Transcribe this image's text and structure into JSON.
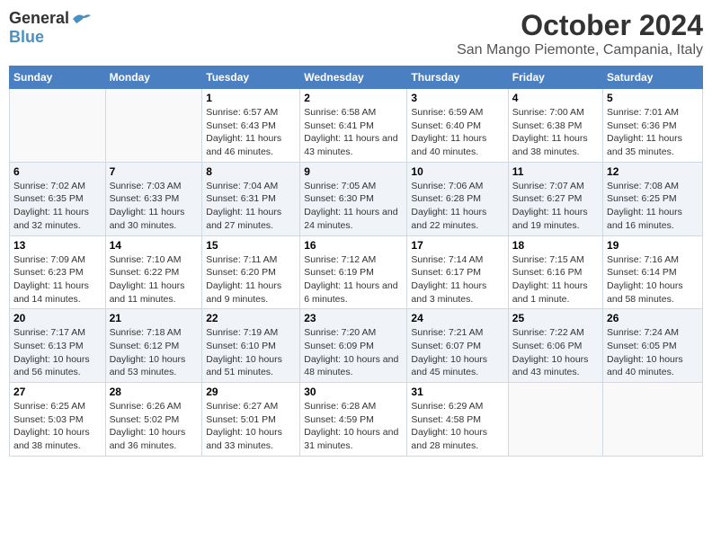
{
  "logo": {
    "general": "General",
    "blue": "Blue"
  },
  "title": "October 2024",
  "location": "San Mango Piemonte, Campania, Italy",
  "weekdays": [
    "Sunday",
    "Monday",
    "Tuesday",
    "Wednesday",
    "Thursday",
    "Friday",
    "Saturday"
  ],
  "weeks": [
    [
      {
        "day": "",
        "sunrise": "",
        "sunset": "",
        "daylight": ""
      },
      {
        "day": "",
        "sunrise": "",
        "sunset": "",
        "daylight": ""
      },
      {
        "day": "1",
        "sunrise": "Sunrise: 6:57 AM",
        "sunset": "Sunset: 6:43 PM",
        "daylight": "Daylight: 11 hours and 46 minutes."
      },
      {
        "day": "2",
        "sunrise": "Sunrise: 6:58 AM",
        "sunset": "Sunset: 6:41 PM",
        "daylight": "Daylight: 11 hours and 43 minutes."
      },
      {
        "day": "3",
        "sunrise": "Sunrise: 6:59 AM",
        "sunset": "Sunset: 6:40 PM",
        "daylight": "Daylight: 11 hours and 40 minutes."
      },
      {
        "day": "4",
        "sunrise": "Sunrise: 7:00 AM",
        "sunset": "Sunset: 6:38 PM",
        "daylight": "Daylight: 11 hours and 38 minutes."
      },
      {
        "day": "5",
        "sunrise": "Sunrise: 7:01 AM",
        "sunset": "Sunset: 6:36 PM",
        "daylight": "Daylight: 11 hours and 35 minutes."
      }
    ],
    [
      {
        "day": "6",
        "sunrise": "Sunrise: 7:02 AM",
        "sunset": "Sunset: 6:35 PM",
        "daylight": "Daylight: 11 hours and 32 minutes."
      },
      {
        "day": "7",
        "sunrise": "Sunrise: 7:03 AM",
        "sunset": "Sunset: 6:33 PM",
        "daylight": "Daylight: 11 hours and 30 minutes."
      },
      {
        "day": "8",
        "sunrise": "Sunrise: 7:04 AM",
        "sunset": "Sunset: 6:31 PM",
        "daylight": "Daylight: 11 hours and 27 minutes."
      },
      {
        "day": "9",
        "sunrise": "Sunrise: 7:05 AM",
        "sunset": "Sunset: 6:30 PM",
        "daylight": "Daylight: 11 hours and 24 minutes."
      },
      {
        "day": "10",
        "sunrise": "Sunrise: 7:06 AM",
        "sunset": "Sunset: 6:28 PM",
        "daylight": "Daylight: 11 hours and 22 minutes."
      },
      {
        "day": "11",
        "sunrise": "Sunrise: 7:07 AM",
        "sunset": "Sunset: 6:27 PM",
        "daylight": "Daylight: 11 hours and 19 minutes."
      },
      {
        "day": "12",
        "sunrise": "Sunrise: 7:08 AM",
        "sunset": "Sunset: 6:25 PM",
        "daylight": "Daylight: 11 hours and 16 minutes."
      }
    ],
    [
      {
        "day": "13",
        "sunrise": "Sunrise: 7:09 AM",
        "sunset": "Sunset: 6:23 PM",
        "daylight": "Daylight: 11 hours and 14 minutes."
      },
      {
        "day": "14",
        "sunrise": "Sunrise: 7:10 AM",
        "sunset": "Sunset: 6:22 PM",
        "daylight": "Daylight: 11 hours and 11 minutes."
      },
      {
        "day": "15",
        "sunrise": "Sunrise: 7:11 AM",
        "sunset": "Sunset: 6:20 PM",
        "daylight": "Daylight: 11 hours and 9 minutes."
      },
      {
        "day": "16",
        "sunrise": "Sunrise: 7:12 AM",
        "sunset": "Sunset: 6:19 PM",
        "daylight": "Daylight: 11 hours and 6 minutes."
      },
      {
        "day": "17",
        "sunrise": "Sunrise: 7:14 AM",
        "sunset": "Sunset: 6:17 PM",
        "daylight": "Daylight: 11 hours and 3 minutes."
      },
      {
        "day": "18",
        "sunrise": "Sunrise: 7:15 AM",
        "sunset": "Sunset: 6:16 PM",
        "daylight": "Daylight: 11 hours and 1 minute."
      },
      {
        "day": "19",
        "sunrise": "Sunrise: 7:16 AM",
        "sunset": "Sunset: 6:14 PM",
        "daylight": "Daylight: 10 hours and 58 minutes."
      }
    ],
    [
      {
        "day": "20",
        "sunrise": "Sunrise: 7:17 AM",
        "sunset": "Sunset: 6:13 PM",
        "daylight": "Daylight: 10 hours and 56 minutes."
      },
      {
        "day": "21",
        "sunrise": "Sunrise: 7:18 AM",
        "sunset": "Sunset: 6:12 PM",
        "daylight": "Daylight: 10 hours and 53 minutes."
      },
      {
        "day": "22",
        "sunrise": "Sunrise: 7:19 AM",
        "sunset": "Sunset: 6:10 PM",
        "daylight": "Daylight: 10 hours and 51 minutes."
      },
      {
        "day": "23",
        "sunrise": "Sunrise: 7:20 AM",
        "sunset": "Sunset: 6:09 PM",
        "daylight": "Daylight: 10 hours and 48 minutes."
      },
      {
        "day": "24",
        "sunrise": "Sunrise: 7:21 AM",
        "sunset": "Sunset: 6:07 PM",
        "daylight": "Daylight: 10 hours and 45 minutes."
      },
      {
        "day": "25",
        "sunrise": "Sunrise: 7:22 AM",
        "sunset": "Sunset: 6:06 PM",
        "daylight": "Daylight: 10 hours and 43 minutes."
      },
      {
        "day": "26",
        "sunrise": "Sunrise: 7:24 AM",
        "sunset": "Sunset: 6:05 PM",
        "daylight": "Daylight: 10 hours and 40 minutes."
      }
    ],
    [
      {
        "day": "27",
        "sunrise": "Sunrise: 6:25 AM",
        "sunset": "Sunset: 5:03 PM",
        "daylight": "Daylight: 10 hours and 38 minutes."
      },
      {
        "day": "28",
        "sunrise": "Sunrise: 6:26 AM",
        "sunset": "Sunset: 5:02 PM",
        "daylight": "Daylight: 10 hours and 36 minutes."
      },
      {
        "day": "29",
        "sunrise": "Sunrise: 6:27 AM",
        "sunset": "Sunset: 5:01 PM",
        "daylight": "Daylight: 10 hours and 33 minutes."
      },
      {
        "day": "30",
        "sunrise": "Sunrise: 6:28 AM",
        "sunset": "Sunset: 4:59 PM",
        "daylight": "Daylight: 10 hours and 31 minutes."
      },
      {
        "day": "31",
        "sunrise": "Sunrise: 6:29 AM",
        "sunset": "Sunset: 4:58 PM",
        "daylight": "Daylight: 10 hours and 28 minutes."
      },
      {
        "day": "",
        "sunrise": "",
        "sunset": "",
        "daylight": ""
      },
      {
        "day": "",
        "sunrise": "",
        "sunset": "",
        "daylight": ""
      }
    ]
  ]
}
